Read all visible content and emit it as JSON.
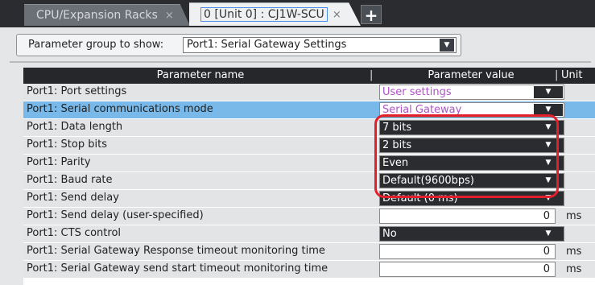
{
  "tabs": [
    {
      "label": "CPU/Expansion Racks",
      "close": "×"
    },
    {
      "label": "0 [Unit 0] : CJ1W-SCU",
      "close": "×"
    }
  ],
  "add_tab": "+",
  "group": {
    "label": "Parameter group to show:",
    "value": "Port1: Serial Gateway Settings"
  },
  "table": {
    "columns": {
      "name": "Parameter name",
      "value": "Parameter value",
      "unit": "Unit"
    },
    "rows": [
      {
        "name": "Port1: Port settings",
        "value": "User settings",
        "unit": ""
      },
      {
        "name": "Port1: Serial communications mode",
        "value": "Serial Gateway",
        "unit": ""
      },
      {
        "name": "Port1: Data length",
        "value": "7 bits",
        "unit": ""
      },
      {
        "name": "Port1: Stop bits",
        "value": "2 bits",
        "unit": ""
      },
      {
        "name": "Port1: Parity",
        "value": "Even",
        "unit": ""
      },
      {
        "name": "Port1: Baud rate",
        "value": "Default(9600bps)",
        "unit": ""
      },
      {
        "name": "Port1: Send delay",
        "value": "Default (0 ms)",
        "unit": ""
      },
      {
        "name": "Port1: Send delay (user-specified)",
        "value": "0",
        "unit": "ms"
      },
      {
        "name": "Port1: CTS control",
        "value": "No",
        "unit": ""
      },
      {
        "name": "Port1: Serial Gateway Response timeout monitoring time",
        "value": "0",
        "unit": "ms"
      },
      {
        "name": "Port1: Serial Gateway send start timeout monitoring time",
        "value": "0",
        "unit": "ms"
      }
    ]
  },
  "colors": {
    "selected_row": "#78b9e9",
    "highlight": "#e21f2a",
    "user_value": "#b051c9"
  }
}
